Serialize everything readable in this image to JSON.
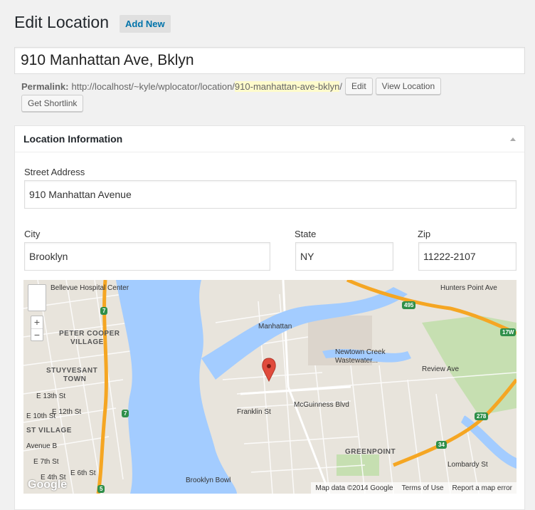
{
  "page": {
    "title": "Edit Location",
    "add_new_label": "Add New",
    "post_title_value": "910 Manhattan Ave, Bklyn"
  },
  "permalink": {
    "label": "Permalink:",
    "base_url": "http://localhost/~kyle/wplocator/location/",
    "slug": "910-manhattan-ave-bklyn",
    "trailing": "/",
    "edit_label": "Edit",
    "view_label": "View Location",
    "shortlink_label": "Get Shortlink"
  },
  "metabox": {
    "title": "Location Information",
    "street_label": "Street Address",
    "street_value": "910 Manhattan Avenue",
    "city_label": "City",
    "city_value": "Brooklyn",
    "state_label": "State",
    "state_value": "NY",
    "zip_label": "Zip",
    "zip_value": "11222-2107"
  },
  "map": {
    "labels": {
      "bellevue": "Bellevue Hospital Center",
      "peter_cooper": "PETER COOPER",
      "village": "VILLAGE",
      "stuyvesant": "STUYVESANT",
      "town": "TOWN",
      "e13": "E 13th St",
      "e12": "E 12th St",
      "e10": "E 10th St",
      "east_village": "ST VILLAGE",
      "avenue_b": "Avenue B",
      "e7": "E 7th St",
      "e6": "E 6th St",
      "e4": "E 4th St",
      "manhattan_av": "Manhattan",
      "newtown": "Newtown Creek",
      "wastewater": "Wastewater...",
      "franklin": "Franklin St",
      "mcguinness": "McGuinness Blvd",
      "greenpoint": "GREENPOINT",
      "brooklyn_bowl": "Brooklyn Bowl",
      "hunters_point": "Hunters Point Ave",
      "review_ave": "Review Ave",
      "lombardy": "Lombardy St"
    },
    "shields": {
      "s7a": "7",
      "s7b": "7",
      "s5": "5",
      "s495": "495",
      "s17w": "17W",
      "s278": "278",
      "s34": "34"
    },
    "zoom_in": "+",
    "zoom_out": "−",
    "logo": "Google",
    "attribution": "Map data ©2014 Google",
    "terms": "Terms of Use",
    "report": "Report a map error",
    "colors": {
      "land": "#e8e4dc",
      "water": "#a3ccff",
      "highway": "#f5a623",
      "park": "#c6dfb1"
    }
  }
}
